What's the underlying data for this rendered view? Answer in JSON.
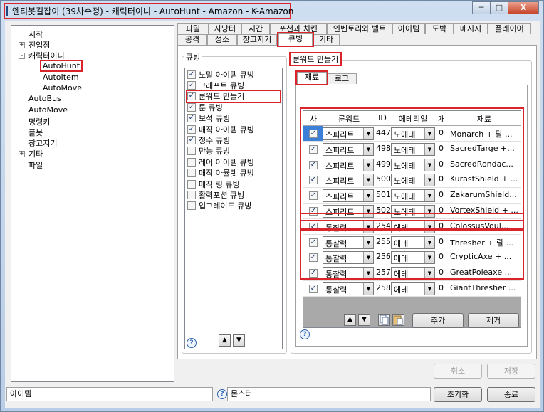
{
  "window": {
    "title": "엔티봇길잡이 (39차수정) - 캐릭터이니 - AutoHunt - Amazon - K-Amazon"
  },
  "titlebar_buttons": {
    "minimize": "─",
    "maximize": "□",
    "close": "X"
  },
  "tree": {
    "items": [
      "시작",
      "진입점",
      "캐릭터이니",
      "AutoHunt",
      "AutoItem",
      "AutoMove",
      "AutoBus",
      "AutoMove",
      "명령키",
      "플봇",
      "창고지기",
      "기타",
      "파일"
    ],
    "expanders": [
      "+",
      "-",
      "+"
    ]
  },
  "tabs_row1": [
    "파일",
    "사냥터",
    "시간",
    "포션과 치킨",
    "인벤토리와 벨트",
    "아이템",
    "도박",
    "메시지",
    "플레이어"
  ],
  "tabs_row2": [
    "공격",
    "성소",
    "창고지기",
    "큐빙",
    "기타"
  ],
  "cubing": {
    "group_title": "큐빙",
    "items": [
      {
        "label": "노말 아이템 큐빙",
        "checked": true
      },
      {
        "label": "크래프트 큐빙",
        "checked": true
      },
      {
        "label": "룬워드 만들기",
        "checked": true
      },
      {
        "label": "룬 큐빙",
        "checked": true
      },
      {
        "label": "보석 큐빙",
        "checked": true
      },
      {
        "label": "매직 아이템 큐빙",
        "checked": true
      },
      {
        "label": "정수 큐빙",
        "checked": true
      },
      {
        "label": "만능 큐빙",
        "checked": false
      },
      {
        "label": "레어 아이템 큐빙",
        "checked": false
      },
      {
        "label": "매직 아뮬렛 큐빙",
        "checked": false
      },
      {
        "label": "매직 링 큐빙",
        "checked": false
      },
      {
        "label": "활력포션 큐빙",
        "checked": false
      },
      {
        "label": "업그레이드 큐빙",
        "checked": false
      }
    ]
  },
  "runeword": {
    "group_title": "룬워드 만들기",
    "subtabs": [
      "재료",
      "로그"
    ],
    "columns": [
      "사",
      "룬워드",
      "ID",
      "에테리얼",
      "개",
      "재료"
    ],
    "rows": [
      {
        "checked": true,
        "runeword": "스피리트",
        "id": "447",
        "ethereal": "노에테",
        "count": "0",
        "material": "Monarch + 탈 ..."
      },
      {
        "checked": true,
        "runeword": "스피리트",
        "id": "498",
        "ethereal": "노에테",
        "count": "0",
        "material": "SacredTarge +..."
      },
      {
        "checked": true,
        "runeword": "스피리트",
        "id": "499",
        "ethereal": "노에테",
        "count": "0",
        "material": "SacredRondac..."
      },
      {
        "checked": true,
        "runeword": "스피리트",
        "id": "500",
        "ethereal": "노에테",
        "count": "0",
        "material": "KurastShield + ..."
      },
      {
        "checked": true,
        "runeword": "스피리트",
        "id": "501",
        "ethereal": "노에테",
        "count": "0",
        "material": "ZakarumShield..."
      },
      {
        "checked": true,
        "runeword": "스피리트",
        "id": "502",
        "ethereal": "노에테",
        "count": "0",
        "material": "VortexShield + ..."
      },
      {
        "checked": true,
        "runeword": "통찰력",
        "id": "254",
        "ethereal": "에테",
        "count": "0",
        "material": "ColossusVoul..."
      },
      {
        "checked": true,
        "runeword": "통찰력",
        "id": "255",
        "ethereal": "에테",
        "count": "0",
        "material": "Thresher + 랄 ..."
      },
      {
        "checked": true,
        "runeword": "통찰력",
        "id": "256",
        "ethereal": "에테",
        "count": "0",
        "material": "CrypticAxe + ..."
      },
      {
        "checked": true,
        "runeword": "통찰력",
        "id": "257",
        "ethereal": "에테",
        "count": "0",
        "material": "GreatPoleaxe ..."
      },
      {
        "checked": true,
        "runeword": "통찰력",
        "id": "258",
        "ethereal": "에테",
        "count": "0",
        "material": "GiantThresher ..."
      }
    ],
    "add_label": "추가",
    "remove_label": "제거"
  },
  "glyphs": {
    "up": "▲",
    "down": "▼",
    "help": "?",
    "dropdown": "▼"
  },
  "buttons": {
    "cancel": "취소",
    "save": "저장",
    "reset": "초기화",
    "close": "종료"
  },
  "statusbar": {
    "item_label": "아이템",
    "monster_label": "몬스터"
  },
  "colors": {
    "highlight": "#d9242b",
    "selection": "#3c7fd6",
    "grid_bg": "#a9a9a9"
  }
}
